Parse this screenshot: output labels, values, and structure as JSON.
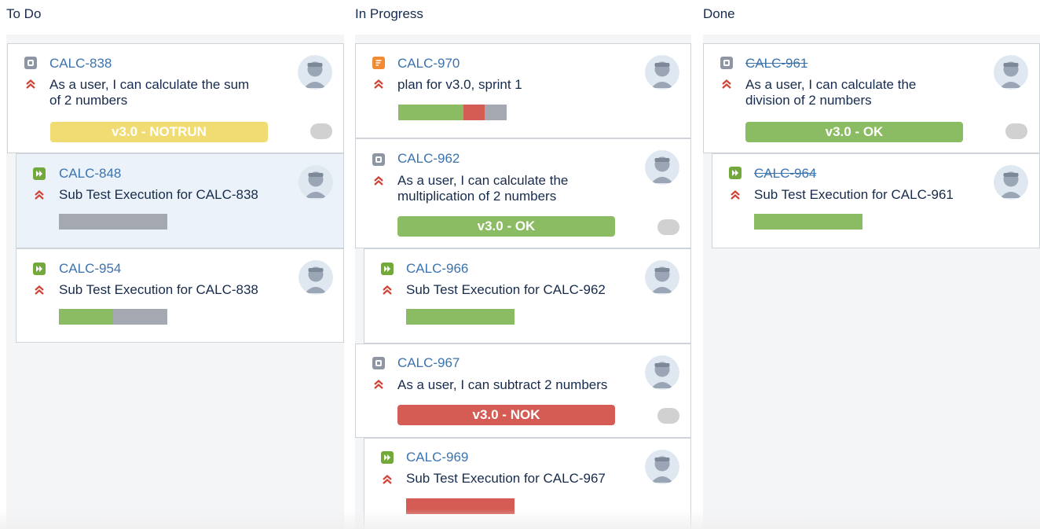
{
  "columns": [
    {
      "title": "To Do"
    },
    {
      "title": "In Progress"
    },
    {
      "title": "Done"
    }
  ],
  "colors": {
    "link": "#3b73af",
    "pass": "#8bbb62",
    "fail": "#d45c55",
    "todo": "#a3a8b1",
    "badge_yellow": "#f0dc73",
    "badge_green": "#8bbb62",
    "badge_red": "#d45c55",
    "priority": "#d04437"
  },
  "cards": {
    "calc838": {
      "key": "CALC-838",
      "summary_line1": "As a user, I can calculate the sum",
      "summary_line2": "of 2 numbers",
      "status": "v3.0 - NOTRUN",
      "icon": "test-icon",
      "priority": "highest-priority-icon"
    },
    "calc848": {
      "key": "CALC-848",
      "summary": "Sub Test Execution for CALC-838",
      "icon": "test-execution-icon",
      "progress": {
        "pass": 0,
        "fail": 0,
        "todo": 1
      }
    },
    "calc954": {
      "key": "CALC-954",
      "summary": "Sub Test Execution for CALC-838",
      "icon": "test-execution-icon",
      "progress": {
        "pass": 0.5,
        "fail": 0,
        "todo": 0.5
      }
    },
    "calc970": {
      "key": "CALC-970",
      "summary": "plan for v3.0, sprint 1",
      "icon": "test-plan-icon",
      "progress": {
        "pass": 0.6,
        "fail": 0.2,
        "todo": 0.2
      }
    },
    "calc962": {
      "key": "CALC-962",
      "summary_line1": "As a user, I can calculate the",
      "summary_line2": "multiplication of 2 numbers",
      "status": "v3.0 - OK",
      "icon": "test-icon"
    },
    "calc966": {
      "key": "CALC-966",
      "summary": "Sub Test Execution for CALC-962",
      "icon": "test-execution-icon",
      "progress": {
        "pass": 1,
        "fail": 0,
        "todo": 0
      }
    },
    "calc967": {
      "key": "CALC-967",
      "summary": "As a user, I can subtract 2 numbers",
      "status": "v3.0 - NOK",
      "icon": "test-icon"
    },
    "calc969": {
      "key": "CALC-969",
      "summary": "Sub Test Execution for CALC-967",
      "icon": "test-execution-icon",
      "progress": {
        "pass": 0,
        "fail": 1,
        "todo": 0
      }
    },
    "calc961": {
      "key": "CALC-961",
      "summary_line1": "As a user, I can calculate the",
      "summary_line2": "division of 2 numbers",
      "status": "v3.0 - OK",
      "icon": "test-icon",
      "resolved": true
    },
    "calc964": {
      "key": "CALC-964",
      "summary": "Sub Test Execution for CALC-961",
      "icon": "test-execution-icon",
      "resolved": true,
      "progress": {
        "pass": 1,
        "fail": 0,
        "todo": 0
      }
    }
  }
}
